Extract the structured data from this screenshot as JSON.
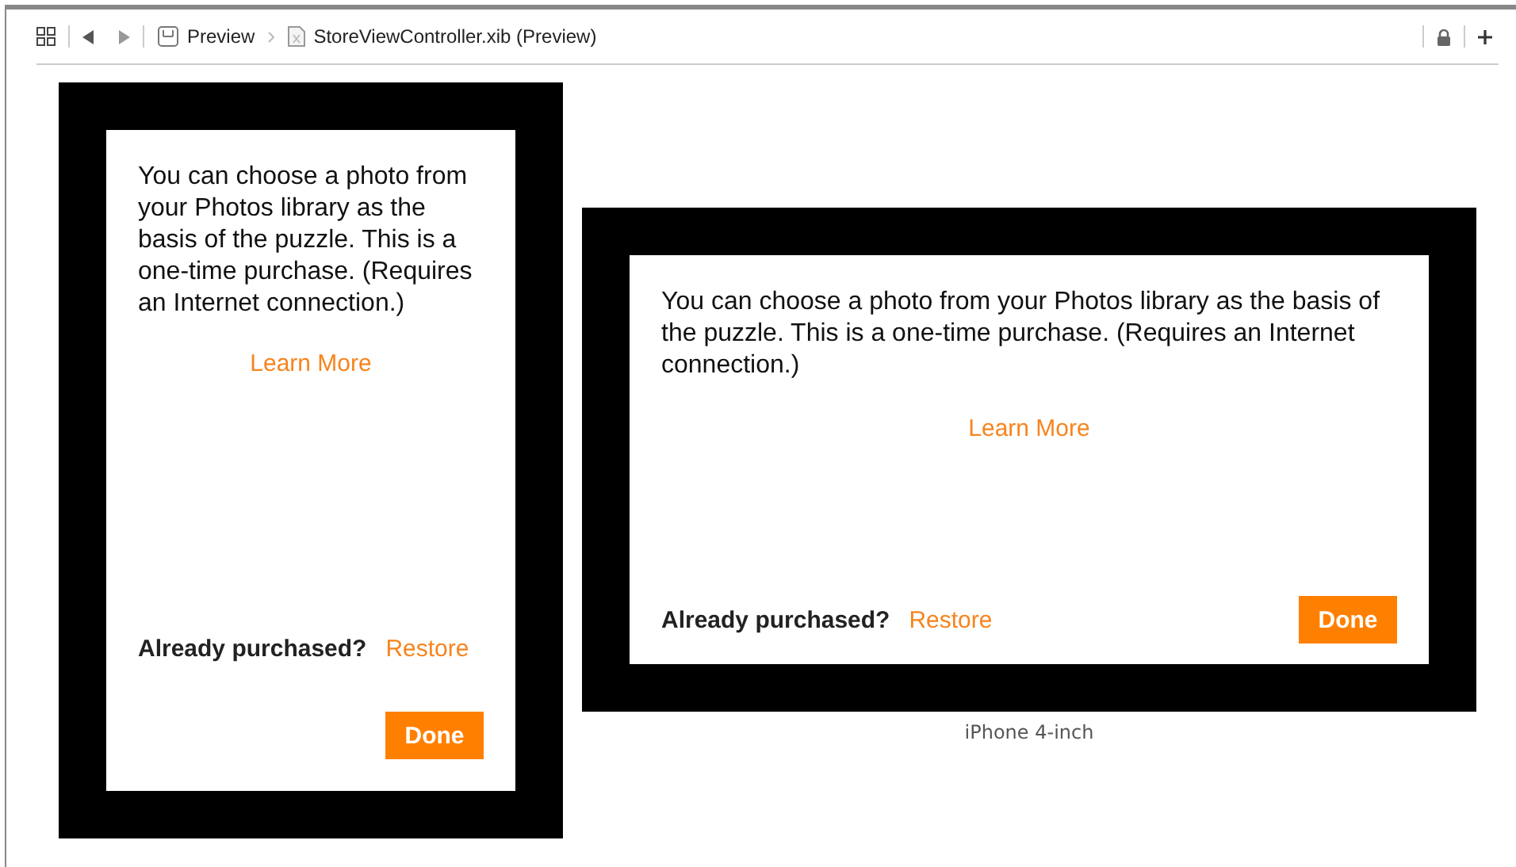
{
  "toolbar": {
    "breadcrumbs": [
      {
        "kind": "app",
        "label": "Preview"
      },
      {
        "kind": "file",
        "label": "StoreViewController.xib (Preview)"
      }
    ]
  },
  "devices": [
    {
      "kind": "portrait",
      "message": "You can choose a photo from your Photos library as the basis of the puzzle. This is a one-time purchase. (Requires an Internet connection.)",
      "learn_more": "Learn More",
      "already_label": "Already purchased?",
      "restore": "Restore",
      "done": "Done"
    },
    {
      "kind": "landscape",
      "caption": "iPhone 4-inch",
      "message": "You can choose a photo from your Photos library as the basis of the puzzle. This is a one-time purchase. (Requires an Internet connection.)",
      "learn_more": "Learn More",
      "already_label": "Already purchased?",
      "restore": "Restore",
      "done": "Done"
    }
  ]
}
